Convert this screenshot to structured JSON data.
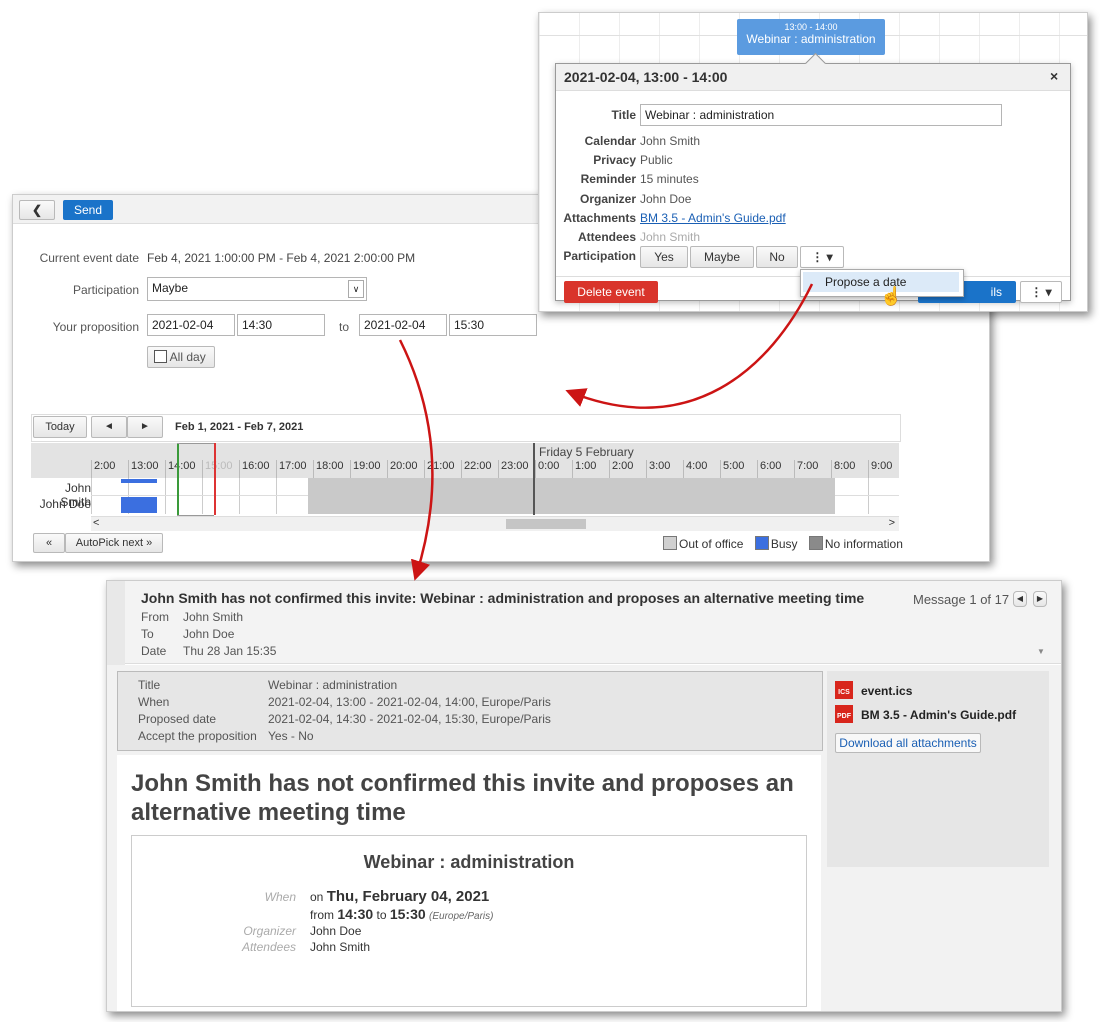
{
  "popup": {
    "event_time": "13:00 - 14:00",
    "event_title": "Webinar : administration",
    "header": "2021-02-04, 13:00 - 14:00",
    "close": "×",
    "fields": {
      "title_label": "Title",
      "title_value": "Webinar : administration",
      "calendar_label": "Calendar",
      "calendar_value": "John Smith",
      "privacy_label": "Privacy",
      "privacy_value": "Public",
      "reminder_label": "Reminder",
      "reminder_value": "15 minutes",
      "organizer_label": "Organizer",
      "organizer_value": "John Doe",
      "attachments_label": "Attachments",
      "attachments_value": "BM 3.5 - Admin's Guide.pdf",
      "attendees_label": "Attendees",
      "attendees_value": "John Smith",
      "participation_label": "Participation"
    },
    "buttons": {
      "yes": "Yes",
      "maybe": "Maybe",
      "no": "No",
      "more": "⋮ ▾",
      "delete": "Delete event",
      "details": "ils",
      "more2": "⋮ ▾"
    },
    "menu_item": "Propose a date"
  },
  "form": {
    "send": "Send",
    "current_label": "Current event date",
    "current_value": "Feb 4, 2021 1:00:00 PM - Feb 4, 2021 2:00:00 PM",
    "participation_label": "Participation",
    "participation_value": "Maybe",
    "proposition_label": "Your proposition",
    "start_date": "2021-02-04",
    "start_time": "14:30",
    "to": "to",
    "end_date": "2021-02-04",
    "end_time": "15:30",
    "allday": "All day",
    "today": "Today",
    "prev": "◄",
    "next": "►",
    "range": "Feb 1, 2021 - Feb 7, 2021",
    "day2": "Friday 5 February",
    "hours_day1": [
      "2:00",
      "13:00",
      "14:00",
      "15:00",
      "16:00",
      "17:00",
      "18:00",
      "19:00",
      "20:00",
      "21:00",
      "22:00",
      "23:00"
    ],
    "hours_day2": [
      "0:00",
      "1:00",
      "2:00",
      "3:00",
      "4:00",
      "5:00",
      "6:00",
      "7:00",
      "8:00",
      "9:00"
    ],
    "rows": [
      "John Smith",
      "John Doe"
    ],
    "scroll_left": "<",
    "scroll_right": ">",
    "autopick_prev": "«",
    "autopick_next": "AutoPick next »",
    "legend": {
      "out": "Out of office",
      "busy": "Busy",
      "noinfo": "No information"
    }
  },
  "mail": {
    "subject": "John Smith has not confirmed this invite: Webinar : administration and proposes an alternative meeting time",
    "counter": "Message 1 of 17",
    "from_label": "From",
    "from_value": "John Smith",
    "to_label": "To",
    "to_value": "John Doe",
    "date_label": "Date",
    "date_value": "Thu 28 Jan 15:35",
    "meta": [
      {
        "k": "Title",
        "v": "Webinar : administration"
      },
      {
        "k": "When",
        "v": "2021-02-04, 13:00 - 2021-02-04, 14:00, Europe/Paris"
      },
      {
        "k": "Proposed date",
        "v": "2021-02-04, 14:30 - 2021-02-04, 15:30, Europe/Paris"
      },
      {
        "k": "Accept the proposition",
        "v": "Yes - No"
      }
    ],
    "attachments": [
      "event.ics",
      "BM 3.5 - Admin's Guide.pdf"
    ],
    "download_all": "Download all attachments",
    "headline": "John Smith has not confirmed this invite and proposes an alternative meeting time",
    "card_title": "Webinar : administration",
    "when_label": "When",
    "on": "on",
    "date_big": "Thu, February 04, 2021",
    "from_word": "from",
    "time_from": "14:30",
    "to_word": "to",
    "time_to": "15:30",
    "tz": "(Europe/Paris)",
    "organizer_label": "Organizer",
    "organizer_value": "John Doe",
    "attendees_label": "Attendees",
    "attendees_value": "John Smith"
  },
  "colors": {
    "blue": "#1a73c9",
    "red": "#cc1414",
    "busy": "#3b6fe0"
  }
}
